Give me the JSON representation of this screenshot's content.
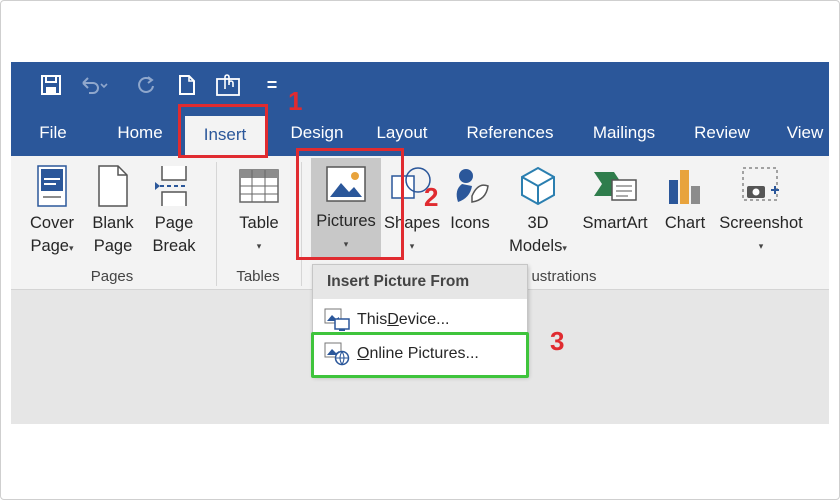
{
  "qat": {
    "icons": [
      "save-icon",
      "undo-icon",
      "redo-icon",
      "new-document-icon",
      "touch-mode-icon",
      "customize-qat-icon"
    ],
    "customize_glyph": "="
  },
  "tabs": [
    {
      "label": "File"
    },
    {
      "label": "Home"
    },
    {
      "label": "Insert",
      "active": true
    },
    {
      "label": "Design"
    },
    {
      "label": "Layout"
    },
    {
      "label": "References"
    },
    {
      "label": "Mailings"
    },
    {
      "label": "Review"
    },
    {
      "label": "View"
    }
  ],
  "ribbon": {
    "cover_page": {
      "line1": "Cover",
      "line2": "Page"
    },
    "blank_page": {
      "line1": "Blank",
      "line2": "Page"
    },
    "page_break": {
      "line1": "Page",
      "line2": "Break"
    },
    "table": {
      "label": "Table"
    },
    "pictures": {
      "label": "Pictures"
    },
    "shapes": {
      "label": "Shapes"
    },
    "icons": {
      "label": "Icons"
    },
    "models3d": {
      "line1": "3D",
      "line2": "Models"
    },
    "smartart": {
      "label": "SmartArt"
    },
    "chart": {
      "label": "Chart"
    },
    "screenshot": {
      "label": "Screenshot"
    },
    "groups": {
      "pages": "Pages",
      "tables": "Tables",
      "illustrations": "ustrations"
    },
    "caret": "▾"
  },
  "menu": {
    "header": "Insert Picture From",
    "items": [
      {
        "pre": "This ",
        "accel": "D",
        "post": "evice..."
      },
      {
        "pre": "",
        "accel": "O",
        "post": "nline Pictures..."
      }
    ]
  },
  "annotations": {
    "step1": "1",
    "step2": "2",
    "step3": "3"
  },
  "colors": {
    "ribbon_blue": "#2b579a",
    "highlight_red": "#e02b30",
    "highlight_green": "#3fc43c"
  }
}
